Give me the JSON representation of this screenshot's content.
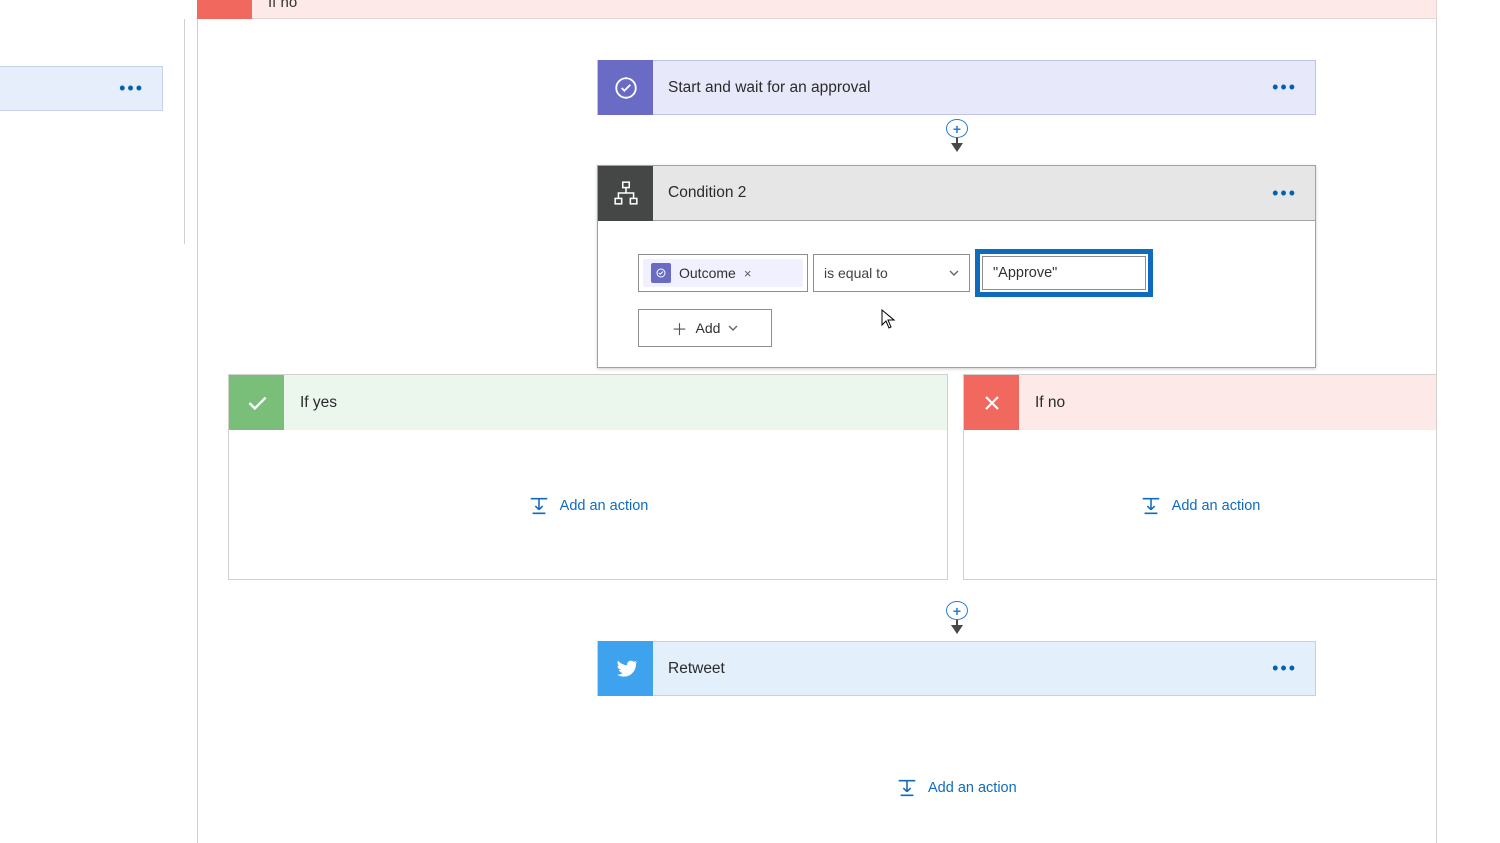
{
  "side": {
    "ellipsis": "•••"
  },
  "top_ifno": {
    "label": "If no"
  },
  "approval": {
    "title": "Start and wait for an approval",
    "ellipsis": "•••"
  },
  "condition": {
    "title": "Condition 2",
    "ellipsis": "•••",
    "token_label": "Outcome",
    "token_remove": "×",
    "operator": "is equal to",
    "value": "\"Approve\"",
    "add_label": "Add"
  },
  "branches": {
    "yes": {
      "label": "If yes",
      "add_action": "Add an action"
    },
    "no": {
      "label": "If no",
      "add_action": "Add an action"
    }
  },
  "retweet": {
    "title": "Retweet",
    "ellipsis": "•••"
  },
  "bottom_add": "Add an action"
}
